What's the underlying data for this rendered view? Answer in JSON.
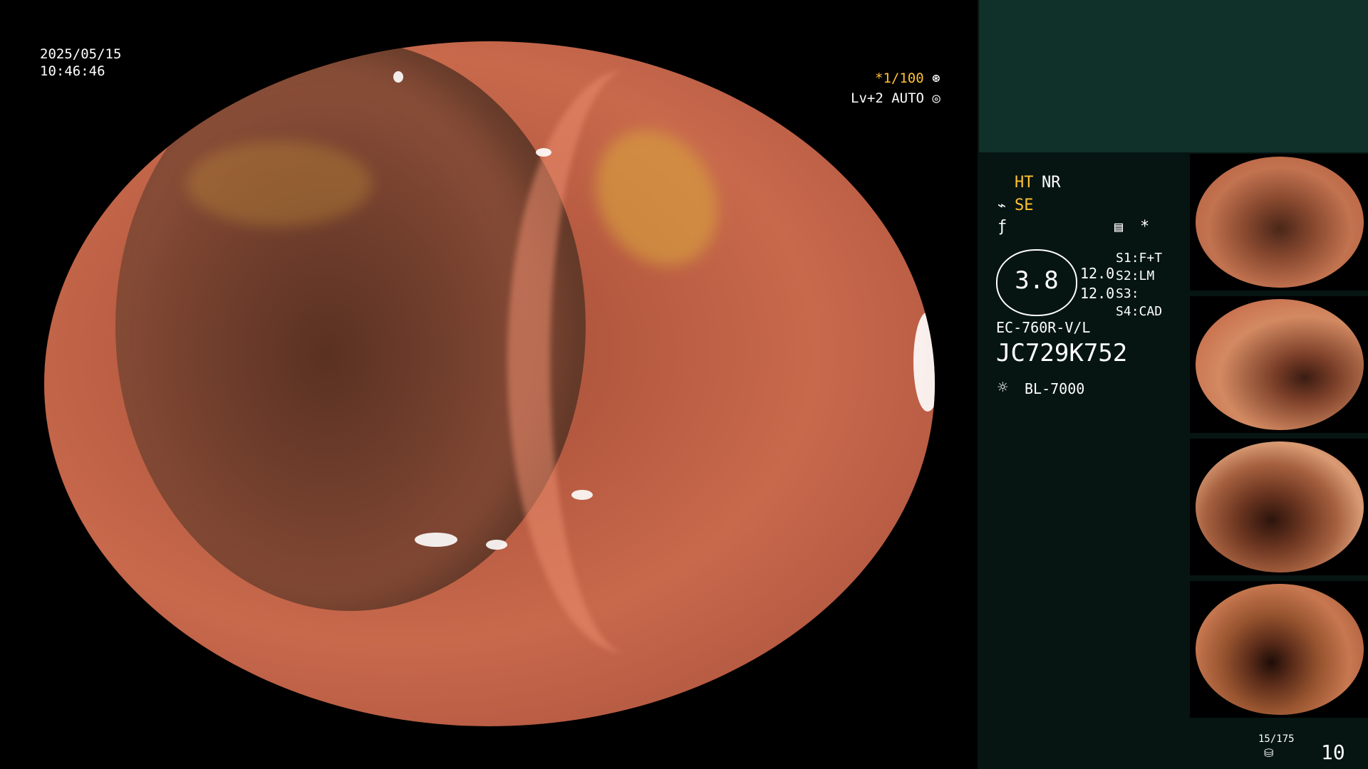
{
  "overlay": {
    "date": "2025/05/15",
    "time": "10:46:46",
    "shutter": "*1/100",
    "level": "Lv+2 AUTO"
  },
  "panel": {
    "mode_ht": "HT",
    "mode_nr": "NR",
    "mode_se": "SE",
    "gauge_value": "3.8",
    "gauge_right_top": "12.0",
    "gauge_right_bottom": "12.0",
    "settings": [
      {
        "key": "S1",
        "value": "F+T"
      },
      {
        "key": "S2",
        "value": "LM"
      },
      {
        "key": "S3",
        "value": ""
      },
      {
        "key": "S4",
        "value": "CAD"
      }
    ],
    "scope_model": "EC-760R-V/L",
    "serial": "JC729K752",
    "light_source": "BL-7000",
    "asterisk": "*",
    "image_count": "15/175",
    "page_number": "10"
  }
}
